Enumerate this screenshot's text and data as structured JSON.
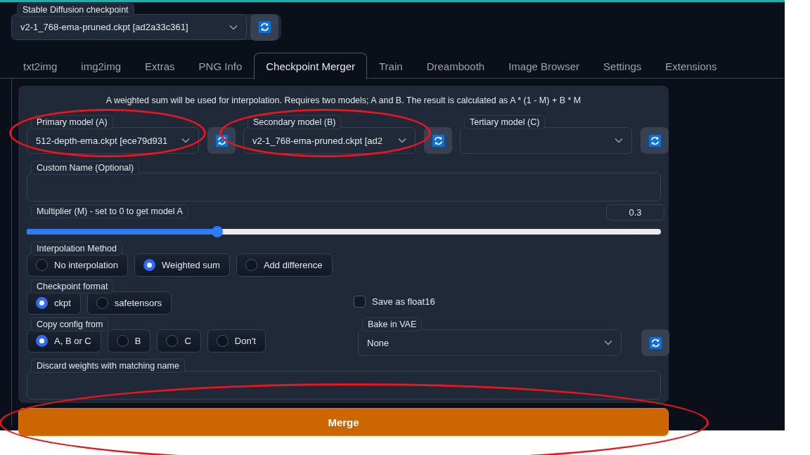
{
  "top_checkpoint": {
    "label": "Stable Diffusion checkpoint",
    "value": "v2-1_768-ema-pruned.ckpt [ad2a33c361]"
  },
  "tabs": [
    {
      "label": "txt2img",
      "selected": false
    },
    {
      "label": "img2img",
      "selected": false
    },
    {
      "label": "Extras",
      "selected": false
    },
    {
      "label": "PNG Info",
      "selected": false
    },
    {
      "label": "Checkpoint Merger",
      "selected": true
    },
    {
      "label": "Train",
      "selected": false
    },
    {
      "label": "Dreambooth",
      "selected": false
    },
    {
      "label": "Image Browser",
      "selected": false
    },
    {
      "label": "Settings",
      "selected": false
    },
    {
      "label": "Extensions",
      "selected": false
    }
  ],
  "merger": {
    "description": "A weighted sum will be used for interpolation. Requires two models; A and B. The result is calculated as A * (1 - M) + B * M",
    "primary_model": {
      "label": "Primary model (A)",
      "value": "512-depth-ema.ckpt [ece79d931",
      "circled": true
    },
    "secondary_model": {
      "label": "Secondary model (B)",
      "value": "v2-1_768-ema-pruned.ckpt [ad2",
      "circled": true
    },
    "tertiary_model": {
      "label": "Tertiary model (C)"
    },
    "custom_name": {
      "label": "Custom Name (Optional)"
    },
    "multiplier": {
      "label": "Multiplier (M) - set to 0 to get model A",
      "value": "0.3",
      "level": 0.3
    },
    "interpolation_method": {
      "label": "Interpolation Method",
      "options": [
        {
          "label": "No interpolation",
          "selected": false
        },
        {
          "label": "Weighted sum",
          "selected": true
        },
        {
          "label": "Add difference",
          "selected": false
        }
      ]
    },
    "checkpoint_format": {
      "label": "Checkpoint format",
      "options": [
        {
          "label": "ckpt",
          "selected": true
        },
        {
          "label": "safetensors",
          "selected": false
        }
      ]
    },
    "save_as_float16": {
      "label": "Save as float16",
      "checked": false
    },
    "copy_config_from": {
      "label": "Copy config from",
      "options": [
        {
          "label": "A, B or C",
          "selected": true
        },
        {
          "label": "B",
          "selected": false
        },
        {
          "label": "C",
          "selected": false
        },
        {
          "label": "Don't",
          "selected": false
        }
      ]
    },
    "bake_in_vae": {
      "label": "Bake in VAE",
      "value": "None"
    },
    "discard_weights": {
      "label": "Discard weights with matching name"
    },
    "merge_button": {
      "label": "Merge",
      "circled": true
    }
  }
}
